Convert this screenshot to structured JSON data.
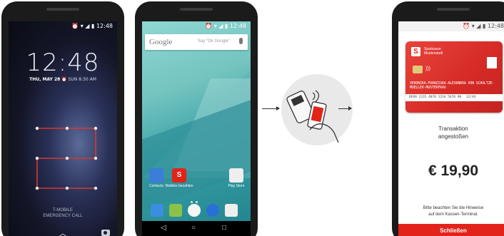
{
  "phone_lock": {
    "status_time": "12:48",
    "time": "12:48",
    "date": "THU, MAY 28",
    "alarm": "SUN 8:30 AM",
    "carrier": "T-MOBILE",
    "emergency": "EMERGENCY CALL"
  },
  "phone_home": {
    "status_time": "12:48",
    "search_brand": "Google",
    "search_hint": "Say \"Ok Google\"",
    "apps": [
      {
        "label": "Contacts"
      },
      {
        "label": "Mobiles bezahlen"
      },
      {
        "label": "Play Store"
      }
    ]
  },
  "phone_pay": {
    "status_time": "12:48",
    "card_bank_line1": "Sparkasse",
    "card_bank_line2": "Musterstadt",
    "card_holder": "VERONIKA-FRANZISKA-ALEXANDRA VON SCHULTZE-MUELLER-MUSTERFRAU",
    "card_number": "DE99 1235 4078 1234 5678 90",
    "card_expiry": "12/XX",
    "status_line1": "Transaktion",
    "status_line2": "angestoßen",
    "amount": "€ 19,90",
    "hint_line1": "Bitte beachten Sie die Hinweise",
    "hint_line2": "auf dem Kassen-Terminal.",
    "close_label": "Schließen"
  },
  "colors": {
    "brand_red": "#e2231a",
    "card_red": "#d52a26",
    "pattern_line": "#d33a2c",
    "home_teal": "#3aa2a7"
  }
}
